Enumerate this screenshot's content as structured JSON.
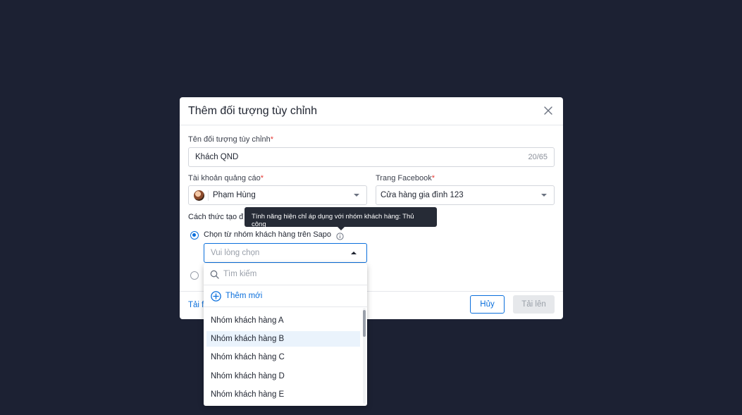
{
  "modal": {
    "title": "Thêm đối tượng tùy chỉnh",
    "name_label": "Tên đối tượng tùy chỉnh",
    "name_value": "Khách QND",
    "name_counter": "20/65",
    "ad_account_label": "Tài khoản quảng cáo",
    "ad_account_value": "Phạm Hùng",
    "fb_page_label": "Trang Facebook",
    "fb_page_value": "Cửa hàng gia đình 123",
    "method_label": "Cách thức tạo đ",
    "option1_label": "Chọn từ nhóm khách hàng trên Sapo",
    "select_placeholder": "Vui lòng chọn",
    "footer_link": "Tải f",
    "cancel_label": "Hủy",
    "upload_label": "Tải lên",
    "required_mark": "*"
  },
  "tooltip": {
    "text": "Tính năng hiện chỉ áp dụng với nhóm khách hàng: Thủ công"
  },
  "dropdown": {
    "search_placeholder": "Tìm kiếm",
    "add_new_label": "Thêm mới",
    "items": [
      "Nhóm khách hàng A",
      "Nhóm khách hàng B",
      "Nhóm khách hàng C",
      "Nhóm khách hàng D",
      "Nhóm khách hàng E"
    ],
    "highlighted_index": 1
  },
  "colors": {
    "backdrop": "#1c2133",
    "primary": "#0a6fdc",
    "required": "#e53935",
    "tooltip_bg": "#262b36",
    "highlight": "#eaf3fc"
  },
  "icons": [
    "close-icon",
    "chevron-down-icon",
    "chevron-up-icon",
    "info-icon",
    "search-icon",
    "plus-circle-icon",
    "avatar"
  ]
}
